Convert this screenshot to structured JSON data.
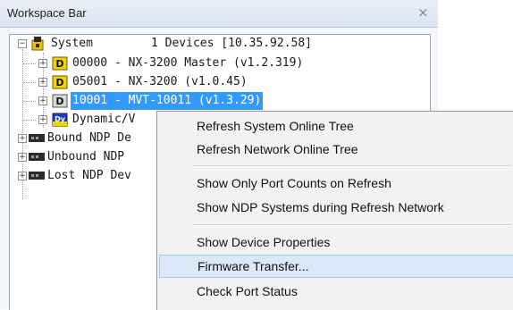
{
  "panel": {
    "title": "Workspace Bar",
    "close_glyph": "×"
  },
  "tree": {
    "system": {
      "label": "System",
      "devices": "1 Devices [10.35.92.58]"
    },
    "devices": [
      {
        "text": "00000 - NX-3200 Master (v1.2.319)",
        "icon": "device-yellow-icon",
        "badge": "D"
      },
      {
        "text": "05001 - NX-3200 (v1.0.45)",
        "icon": "device-yellow-icon",
        "badge": "D"
      },
      {
        "text": "10001 - MVT-10011 (v1.3.29)",
        "icon": "device-gray-icon",
        "badge": "D",
        "selected": true
      },
      {
        "text": "Dynamic/V",
        "icon": "dynamic-device-icon",
        "badge": "Dy"
      }
    ],
    "ndp": [
      {
        "text": "Bound NDP De"
      },
      {
        "text": "Unbound NDP"
      },
      {
        "text": "Lost NDP Dev"
      }
    ]
  },
  "context_menu": {
    "items": [
      {
        "label": "Refresh System Online Tree"
      },
      {
        "label": "Refresh Network Online Tree"
      },
      {
        "label": "Show Only Port Counts on Refresh"
      },
      {
        "label": "Show NDP Systems during Refresh Network"
      },
      {
        "label": "Show Device Properties"
      },
      {
        "label": "Firmware Transfer...",
        "highlighted": true
      },
      {
        "label": "Check Port Status"
      }
    ]
  },
  "colors": {
    "selection": "#3399ff",
    "menu_highlight": "#dbe8f8",
    "device_yellow": "#f2d200",
    "system_yellow": "#e8c400"
  }
}
